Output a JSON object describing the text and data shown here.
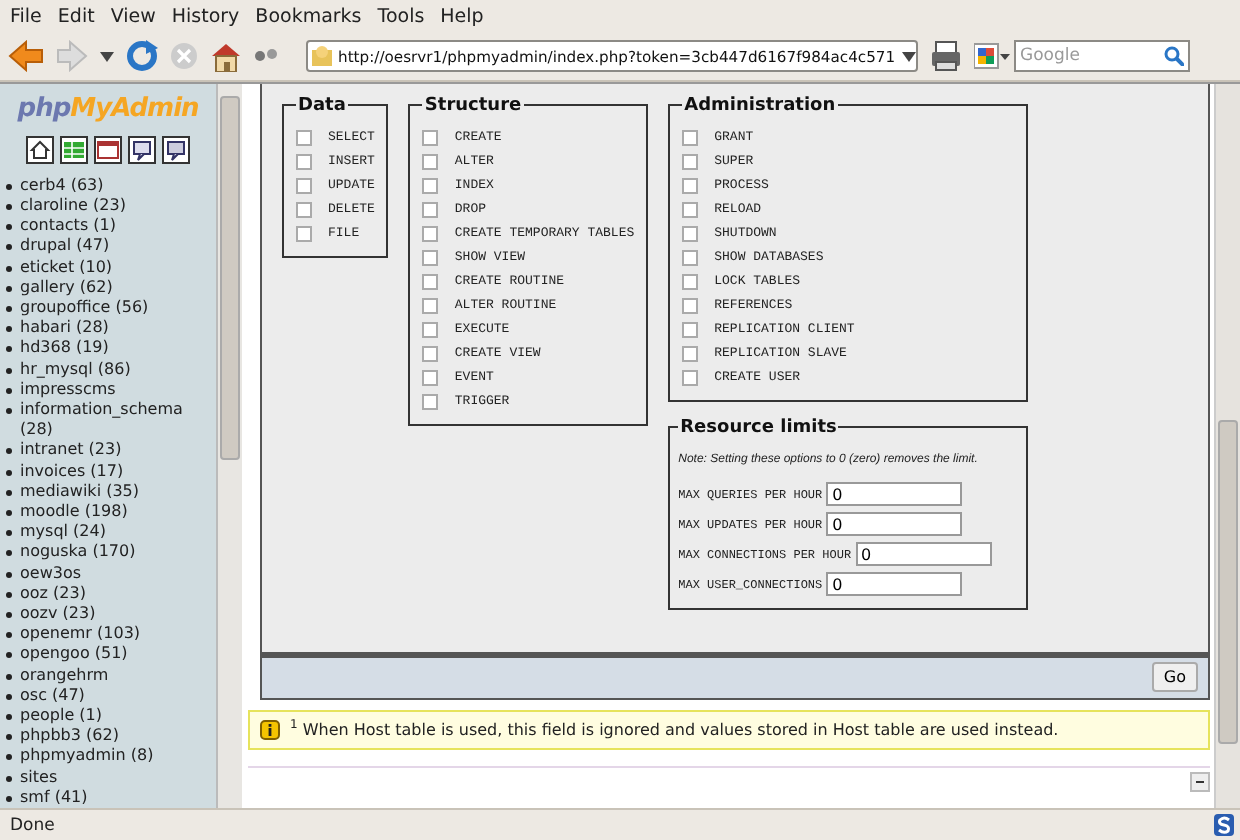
{
  "menu": [
    {
      "label": "File"
    },
    {
      "label": "Edit"
    },
    {
      "label": "View"
    },
    {
      "label": "History"
    },
    {
      "label": "Bookmarks"
    },
    {
      "label": "Tools"
    },
    {
      "label": "Help"
    }
  ],
  "address": {
    "value": "http://oesrvr1/phpmyadmin/index.php?token=3cb447d6167f984ac4c571"
  },
  "search": {
    "placeholder": "Google"
  },
  "sidebar": {
    "logo": [
      "php",
      "MyAdmin"
    ],
    "databases": [
      "cerb4 (63)",
      "claroline (23)",
      "contacts (1)",
      "drupal (47)",
      "eticket (10)",
      "gallery (62)",
      "groupoffice (56)",
      "habari (28)",
      "hd368 (19)",
      "hr_mysql (86)",
      "impresscms",
      "information_schema (28)",
      "intranet (23)",
      "invoices (17)",
      "mediawiki (35)",
      "moodle (198)",
      "mysql (24)",
      "noguska (170)",
      "oew3os",
      "ooz (23)",
      "oozv (23)",
      "openemr (103)",
      "opengoo (51)",
      "orangehrm",
      "osc (47)",
      "people (1)",
      "phpbb3 (62)",
      "phpmyadmin (8)",
      "sites",
      "smf (41)"
    ]
  },
  "privileges": [
    {
      "title": "Data",
      "items": [
        {
          "label": "SELECT",
          "checked": false
        },
        {
          "label": "INSERT",
          "checked": false
        },
        {
          "label": "UPDATE",
          "checked": false
        },
        {
          "label": "DELETE",
          "checked": false
        },
        {
          "label": "FILE",
          "checked": false
        }
      ]
    },
    {
      "title": "Structure",
      "items": [
        {
          "label": "CREATE",
          "checked": false
        },
        {
          "label": "ALTER",
          "checked": false
        },
        {
          "label": "INDEX",
          "checked": false
        },
        {
          "label": "DROP",
          "checked": false
        },
        {
          "label": "CREATE TEMPORARY TABLES",
          "checked": false
        },
        {
          "label": "SHOW VIEW",
          "checked": false
        },
        {
          "label": "CREATE ROUTINE",
          "checked": false
        },
        {
          "label": "ALTER ROUTINE",
          "checked": false
        },
        {
          "label": "EXECUTE",
          "checked": false
        },
        {
          "label": "CREATE VIEW",
          "checked": false
        },
        {
          "label": "EVENT",
          "checked": false
        },
        {
          "label": "TRIGGER",
          "checked": false
        }
      ]
    },
    {
      "title": "Administration",
      "items": [
        {
          "label": "GRANT",
          "checked": false
        },
        {
          "label": "SUPER",
          "checked": false
        },
        {
          "label": "PROCESS",
          "checked": false
        },
        {
          "label": "RELOAD",
          "checked": false
        },
        {
          "label": "SHUTDOWN",
          "checked": false
        },
        {
          "label": "SHOW DATABASES",
          "checked": false
        },
        {
          "label": "LOCK TABLES",
          "checked": false
        },
        {
          "label": "REFERENCES",
          "checked": false
        },
        {
          "label": "REPLICATION CLIENT",
          "checked": false
        },
        {
          "label": "REPLICATION SLAVE",
          "checked": false
        },
        {
          "label": "CREATE USER",
          "checked": false
        }
      ]
    }
  ],
  "resource_limits": {
    "title": "Resource limits",
    "note": "Note: Setting these options to 0 (zero) removes the limit.",
    "fields": [
      {
        "label": "MAX QUERIES PER HOUR",
        "value": "0"
      },
      {
        "label": "MAX UPDATES PER HOUR",
        "value": "0"
      },
      {
        "label": "MAX CONNECTIONS PER HOUR",
        "value": "0"
      },
      {
        "label": "MAX USER_CONNECTIONS",
        "value": "0"
      }
    ]
  },
  "go_button": "Go",
  "notice": "$^{1}$ When Host table is used, this field is ignored and values stored in Host table are used instead.",
  "status_bar": "Done"
}
